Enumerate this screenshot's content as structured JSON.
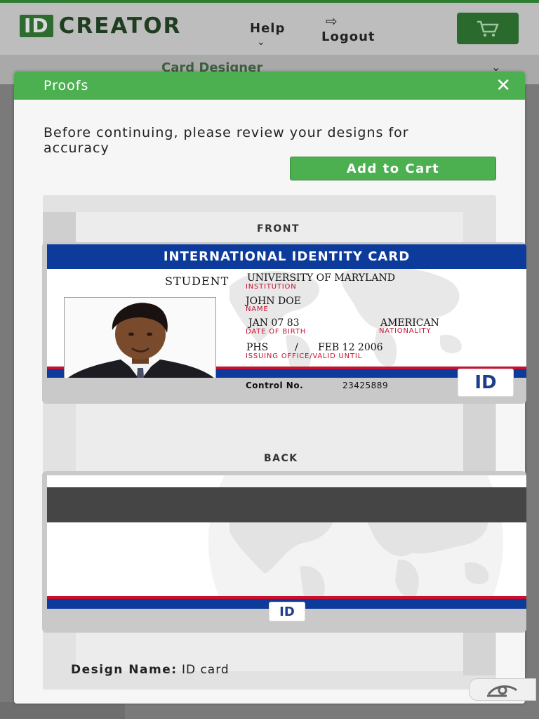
{
  "header": {
    "logo_badge": "ID",
    "logo_text": "CREATOR",
    "help": "Help",
    "logout": "Logout"
  },
  "subbar": {
    "label": "Card Designer"
  },
  "modal": {
    "title": "Proofs",
    "intro": "Before continuing, please review your designs for accuracy",
    "add_to_cart": "Add to Cart",
    "front_label": "FRONT",
    "back_label": "BACK",
    "design_name_label": "Design Name:",
    "design_name_value": "ID card"
  },
  "card": {
    "banner": "INTERNATIONAL IDENTITY CARD",
    "student": "STUDENT",
    "institution": "UNIVERSITY OF MARYLAND",
    "institution_label": "INSTITUTION",
    "name": "JOHN DOE",
    "name_label": "NAME",
    "dob": "JAN 07 83",
    "dob_label": "DATE OF BIRTH",
    "nationality": "AMERICAN",
    "nationality_label": "NATIONALITY",
    "office": "PHS",
    "separator": "/",
    "valid_until": "FEB 12 2006",
    "office_label": "ISSUING OFFICE/VALID UNTIL",
    "control_label": "Control No.",
    "control_value": "23425889",
    "badge": "ID"
  },
  "colors": {
    "accent": "#4caf50",
    "card_blue": "#0d3b9c",
    "card_red": "#c8102e"
  },
  "icons": [
    "cart-icon",
    "logout-icon",
    "chevron-down-icon",
    "close-icon",
    "world-map",
    "eye-icon"
  ]
}
